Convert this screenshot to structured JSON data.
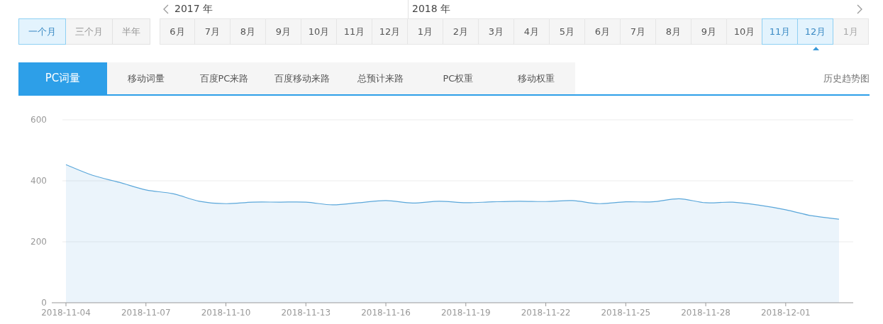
{
  "period_buttons": [
    {
      "label": "一个月",
      "selected": true
    },
    {
      "label": "三个月",
      "selected": false
    },
    {
      "label": "半年",
      "selected": false
    }
  ],
  "year_groups": [
    {
      "year": "2017 年",
      "months": [
        {
          "label": "6月",
          "selected": false,
          "disabled": false,
          "current": false
        },
        {
          "label": "7月",
          "selected": false,
          "disabled": false,
          "current": false
        },
        {
          "label": "8月",
          "selected": false,
          "disabled": false,
          "current": false
        },
        {
          "label": "9月",
          "selected": false,
          "disabled": false,
          "current": false
        },
        {
          "label": "10月",
          "selected": false,
          "disabled": false,
          "current": false
        },
        {
          "label": "11月",
          "selected": false,
          "disabled": false,
          "current": false
        },
        {
          "label": "12月",
          "selected": false,
          "disabled": false,
          "current": false
        }
      ]
    },
    {
      "year": "2018 年",
      "months": [
        {
          "label": "1月",
          "selected": false,
          "disabled": false,
          "current": false
        },
        {
          "label": "2月",
          "selected": false,
          "disabled": false,
          "current": false
        },
        {
          "label": "3月",
          "selected": false,
          "disabled": false,
          "current": false
        },
        {
          "label": "4月",
          "selected": false,
          "disabled": false,
          "current": false
        },
        {
          "label": "5月",
          "selected": false,
          "disabled": false,
          "current": false
        },
        {
          "label": "6月",
          "selected": false,
          "disabled": false,
          "current": false
        },
        {
          "label": "7月",
          "selected": false,
          "disabled": false,
          "current": false
        },
        {
          "label": "8月",
          "selected": false,
          "disabled": false,
          "current": false
        },
        {
          "label": "9月",
          "selected": false,
          "disabled": false,
          "current": false
        },
        {
          "label": "10月",
          "selected": false,
          "disabled": false,
          "current": false
        },
        {
          "label": "11月",
          "selected": true,
          "disabled": false,
          "current": false
        },
        {
          "label": "12月",
          "selected": true,
          "disabled": false,
          "current": true
        },
        {
          "label": "1月",
          "selected": false,
          "disabled": true,
          "current": false
        }
      ]
    }
  ],
  "tabs": [
    {
      "label": "PC词量",
      "selected": true
    },
    {
      "label": "移动词量",
      "selected": false
    },
    {
      "label": "百度PC来路",
      "selected": false
    },
    {
      "label": "百度移动来路",
      "selected": false
    },
    {
      "label": "总预计来路",
      "selected": false
    },
    {
      "label": "PC权重",
      "selected": false
    },
    {
      "label": "移动权重",
      "selected": false
    }
  ],
  "history_link": "历史趋势图",
  "chart_data": {
    "type": "area",
    "categories": [
      "2018-11-04",
      null,
      null,
      "2018-11-07",
      null,
      null,
      "2018-11-10",
      null,
      null,
      "2018-11-13",
      null,
      null,
      "2018-11-16",
      null,
      null,
      "2018-11-19",
      null,
      null,
      "2018-11-22",
      null,
      null,
      "2018-11-25",
      null,
      null,
      "2018-11-28",
      null,
      null,
      "2018-12-01",
      null,
      null
    ],
    "series": [
      {
        "color": "#5ba7da",
        "values": [
          453,
          418,
          395,
          370,
          358,
          333,
          325,
          330,
          330,
          330,
          321,
          328,
          335,
          327,
          333,
          328,
          331,
          333,
          332,
          335,
          325,
          331,
          331,
          341,
          328,
          330,
          320,
          305,
          285,
          274
        ]
      }
    ],
    "ylim": [
      0,
      600
    ],
    "yticks": [
      0,
      200,
      400,
      600
    ]
  }
}
